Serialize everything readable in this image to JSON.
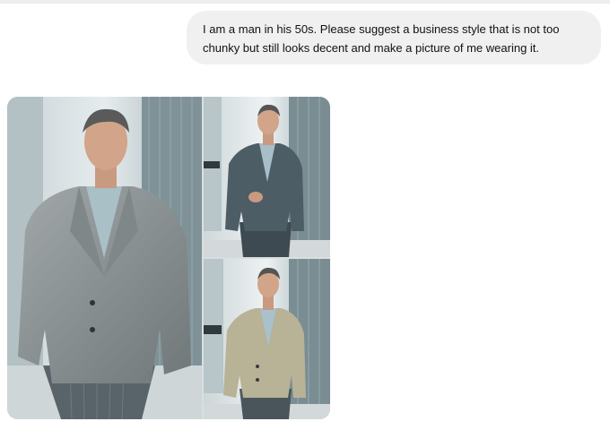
{
  "conversation": {
    "user_message": {
      "text": "I am a man in his 50s. Please suggest a business style that is not too chunky but still looks decent and make a picture of me wearing it."
    },
    "assistant_response": {
      "images": [
        {
          "suit_color": "#8b9294",
          "shirt_color": "#a9c0c6"
        },
        {
          "suit_color": "#4d5d66",
          "shirt_color": "#a7bfc9"
        },
        {
          "suit_color": "#b8b296",
          "shirt_color": "#a9c1ca"
        }
      ]
    }
  },
  "colors": {
    "bubble_bg": "#f0f0f0",
    "text": "#111111",
    "background": "#ffffff"
  }
}
